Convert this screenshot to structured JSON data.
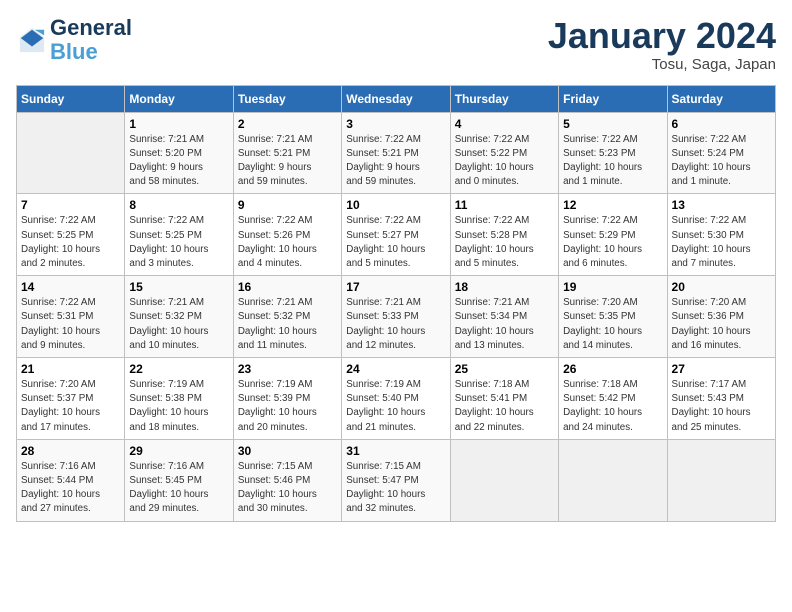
{
  "logo": {
    "line1": "General",
    "line2": "Blue"
  },
  "title": "January 2024",
  "location": "Tosu, Saga, Japan",
  "days_of_week": [
    "Sunday",
    "Monday",
    "Tuesday",
    "Wednesday",
    "Thursday",
    "Friday",
    "Saturday"
  ],
  "weeks": [
    [
      {
        "num": "",
        "info": ""
      },
      {
        "num": "1",
        "info": "Sunrise: 7:21 AM\nSunset: 5:20 PM\nDaylight: 9 hours\nand 58 minutes."
      },
      {
        "num": "2",
        "info": "Sunrise: 7:21 AM\nSunset: 5:21 PM\nDaylight: 9 hours\nand 59 minutes."
      },
      {
        "num": "3",
        "info": "Sunrise: 7:22 AM\nSunset: 5:21 PM\nDaylight: 9 hours\nand 59 minutes."
      },
      {
        "num": "4",
        "info": "Sunrise: 7:22 AM\nSunset: 5:22 PM\nDaylight: 10 hours\nand 0 minutes."
      },
      {
        "num": "5",
        "info": "Sunrise: 7:22 AM\nSunset: 5:23 PM\nDaylight: 10 hours\nand 1 minute."
      },
      {
        "num": "6",
        "info": "Sunrise: 7:22 AM\nSunset: 5:24 PM\nDaylight: 10 hours\nand 1 minute."
      }
    ],
    [
      {
        "num": "7",
        "info": "Sunrise: 7:22 AM\nSunset: 5:25 PM\nDaylight: 10 hours\nand 2 minutes."
      },
      {
        "num": "8",
        "info": "Sunrise: 7:22 AM\nSunset: 5:25 PM\nDaylight: 10 hours\nand 3 minutes."
      },
      {
        "num": "9",
        "info": "Sunrise: 7:22 AM\nSunset: 5:26 PM\nDaylight: 10 hours\nand 4 minutes."
      },
      {
        "num": "10",
        "info": "Sunrise: 7:22 AM\nSunset: 5:27 PM\nDaylight: 10 hours\nand 5 minutes."
      },
      {
        "num": "11",
        "info": "Sunrise: 7:22 AM\nSunset: 5:28 PM\nDaylight: 10 hours\nand 5 minutes."
      },
      {
        "num": "12",
        "info": "Sunrise: 7:22 AM\nSunset: 5:29 PM\nDaylight: 10 hours\nand 6 minutes."
      },
      {
        "num": "13",
        "info": "Sunrise: 7:22 AM\nSunset: 5:30 PM\nDaylight: 10 hours\nand 7 minutes."
      }
    ],
    [
      {
        "num": "14",
        "info": "Sunrise: 7:22 AM\nSunset: 5:31 PM\nDaylight: 10 hours\nand 9 minutes."
      },
      {
        "num": "15",
        "info": "Sunrise: 7:21 AM\nSunset: 5:32 PM\nDaylight: 10 hours\nand 10 minutes."
      },
      {
        "num": "16",
        "info": "Sunrise: 7:21 AM\nSunset: 5:32 PM\nDaylight: 10 hours\nand 11 minutes."
      },
      {
        "num": "17",
        "info": "Sunrise: 7:21 AM\nSunset: 5:33 PM\nDaylight: 10 hours\nand 12 minutes."
      },
      {
        "num": "18",
        "info": "Sunrise: 7:21 AM\nSunset: 5:34 PM\nDaylight: 10 hours\nand 13 minutes."
      },
      {
        "num": "19",
        "info": "Sunrise: 7:20 AM\nSunset: 5:35 PM\nDaylight: 10 hours\nand 14 minutes."
      },
      {
        "num": "20",
        "info": "Sunrise: 7:20 AM\nSunset: 5:36 PM\nDaylight: 10 hours\nand 16 minutes."
      }
    ],
    [
      {
        "num": "21",
        "info": "Sunrise: 7:20 AM\nSunset: 5:37 PM\nDaylight: 10 hours\nand 17 minutes."
      },
      {
        "num": "22",
        "info": "Sunrise: 7:19 AM\nSunset: 5:38 PM\nDaylight: 10 hours\nand 18 minutes."
      },
      {
        "num": "23",
        "info": "Sunrise: 7:19 AM\nSunset: 5:39 PM\nDaylight: 10 hours\nand 20 minutes."
      },
      {
        "num": "24",
        "info": "Sunrise: 7:19 AM\nSunset: 5:40 PM\nDaylight: 10 hours\nand 21 minutes."
      },
      {
        "num": "25",
        "info": "Sunrise: 7:18 AM\nSunset: 5:41 PM\nDaylight: 10 hours\nand 22 minutes."
      },
      {
        "num": "26",
        "info": "Sunrise: 7:18 AM\nSunset: 5:42 PM\nDaylight: 10 hours\nand 24 minutes."
      },
      {
        "num": "27",
        "info": "Sunrise: 7:17 AM\nSunset: 5:43 PM\nDaylight: 10 hours\nand 25 minutes."
      }
    ],
    [
      {
        "num": "28",
        "info": "Sunrise: 7:16 AM\nSunset: 5:44 PM\nDaylight: 10 hours\nand 27 minutes."
      },
      {
        "num": "29",
        "info": "Sunrise: 7:16 AM\nSunset: 5:45 PM\nDaylight: 10 hours\nand 29 minutes."
      },
      {
        "num": "30",
        "info": "Sunrise: 7:15 AM\nSunset: 5:46 PM\nDaylight: 10 hours\nand 30 minutes."
      },
      {
        "num": "31",
        "info": "Sunrise: 7:15 AM\nSunset: 5:47 PM\nDaylight: 10 hours\nand 32 minutes."
      },
      {
        "num": "",
        "info": ""
      },
      {
        "num": "",
        "info": ""
      },
      {
        "num": "",
        "info": ""
      }
    ]
  ]
}
